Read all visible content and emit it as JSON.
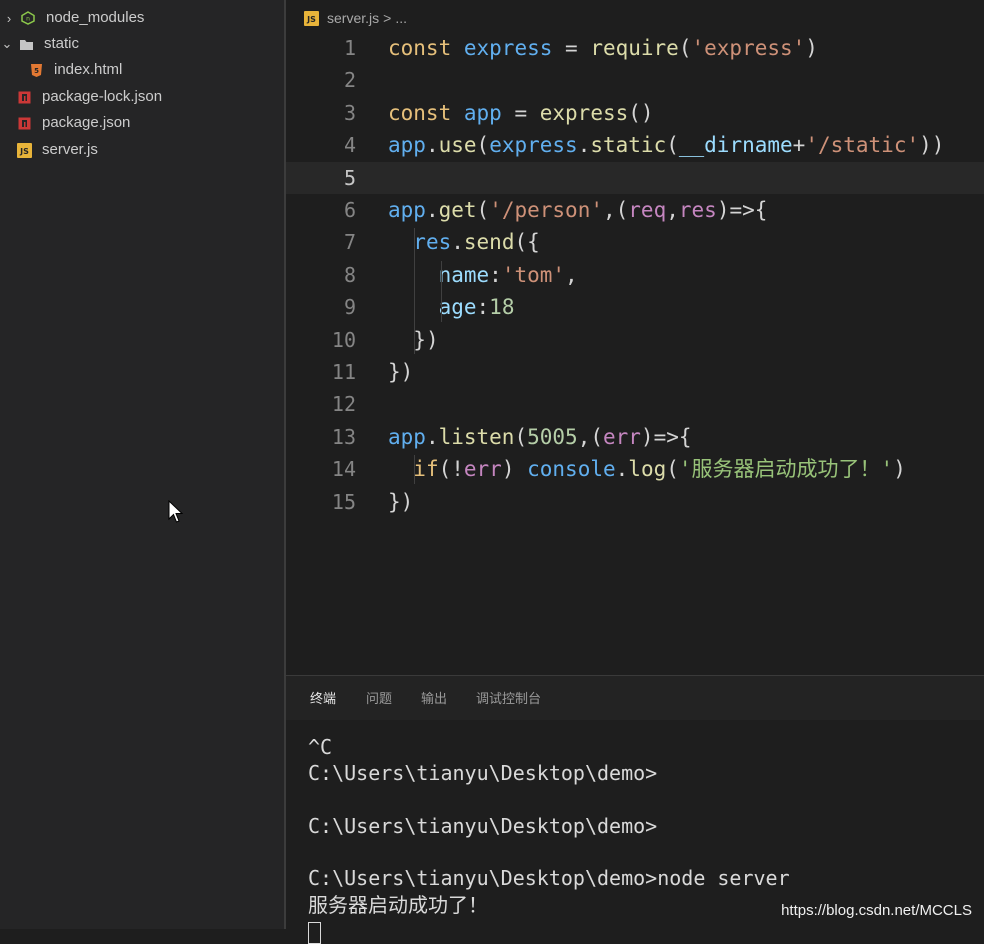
{
  "explorer": {
    "items": [
      {
        "label": "node_modules",
        "icon": "node-modules-icon",
        "chevron": "›",
        "indent": 0
      },
      {
        "label": "static",
        "icon": "folder-icon",
        "chevron": "⌄",
        "indent": 0
      },
      {
        "label": "index.html",
        "icon": "html5-icon",
        "chevron": "",
        "indent": 1
      },
      {
        "label": "package-lock.json",
        "icon": "npm-icon",
        "chevron": "",
        "indent": 0
      },
      {
        "label": "package.json",
        "icon": "npm-icon",
        "chevron": "",
        "indent": 0
      },
      {
        "label": "server.js",
        "icon": "js-icon",
        "chevron": "",
        "indent": 0
      }
    ]
  },
  "editor": {
    "breadcrumb": {
      "file": "server.js",
      "separator": ">",
      "more": "..."
    },
    "current_line": 5,
    "lines": [
      {
        "num": "1"
      },
      {
        "num": "2"
      },
      {
        "num": "3"
      },
      {
        "num": "4"
      },
      {
        "num": "5"
      },
      {
        "num": "6"
      },
      {
        "num": "7"
      },
      {
        "num": "8"
      },
      {
        "num": "9"
      },
      {
        "num": "10"
      },
      {
        "num": "11"
      },
      {
        "num": "12"
      },
      {
        "num": "13"
      },
      {
        "num": "14"
      },
      {
        "num": "15"
      }
    ],
    "code": {
      "l1": [
        "const",
        " ",
        "express",
        " = ",
        "require",
        "(",
        "'express'",
        ")"
      ],
      "l3": [
        "const",
        " ",
        "app",
        " = ",
        "express",
        "()"
      ],
      "l4": [
        "app",
        ".",
        "use",
        "(",
        "express",
        ".",
        "static",
        "(",
        "__dirname",
        "+",
        "'/static'",
        "))"
      ],
      "l6": [
        "app",
        ".",
        "get",
        "(",
        "'/person'",
        ",(",
        "req",
        ",",
        "res",
        ")=>{"
      ],
      "l7": [
        "  ",
        "res",
        ".",
        "send",
        "({"
      ],
      "l8": [
        "    ",
        "name",
        ":",
        "'tom'",
        ","
      ],
      "l9": [
        "    ",
        "age",
        ":",
        "18"
      ],
      "l10": [
        "  ",
        "})"
      ],
      "l11": [
        "})"
      ],
      "l13": [
        "app",
        ".",
        "listen",
        "(",
        "5005",
        ",(",
        "err",
        ")=>{"
      ],
      "l14": [
        "  ",
        "if",
        "(!",
        "err",
        ") ",
        "console",
        ".",
        "log",
        "(",
        "'服务器启动成功了！'",
        ")"
      ],
      "l15": [
        "})"
      ]
    }
  },
  "panel": {
    "tabs": [
      {
        "label": "终端",
        "active": true
      },
      {
        "label": "问题",
        "active": false
      },
      {
        "label": "输出",
        "active": false
      },
      {
        "label": "调试控制台",
        "active": false
      }
    ],
    "terminal_lines": [
      "^C",
      "C:\\Users\\tianyu\\Desktop\\demo>",
      "",
      "C:\\Users\\tianyu\\Desktop\\demo>",
      "",
      "C:\\Users\\tianyu\\Desktop\\demo>node server",
      "服务器启动成功了！"
    ]
  },
  "watermark": "https://blog.csdn.net/MCCLS",
  "colors": {
    "explorer_bg": "#252526",
    "editor_bg": "#1e1e1e",
    "keyword": "#e6c07b",
    "variable": "#61afef",
    "string": "#ce9178"
  }
}
